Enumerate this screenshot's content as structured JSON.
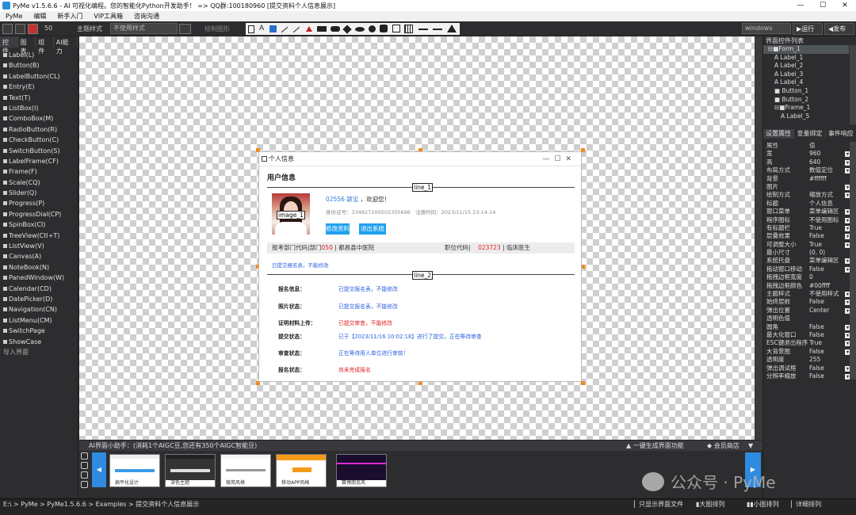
{
  "title_bar": {
    "text": "PyMe v1.5.6.6 - AI 可视化编程。您的智能化Python开发助手！ => QQ群:100180960    [提交资料个人信息展示]",
    "min": "—",
    "max": "☐",
    "close": "✕"
  },
  "menu": [
    "PyMe",
    "编辑",
    "新手入门",
    "VIP工具箱",
    "咨询沟通"
  ],
  "toolbar": {
    "zoom": "50",
    "theme_label": "主题样式",
    "theme_value": "不使用样式",
    "draw_label": "绘制图形",
    "platform": "windows",
    "run": "▶运行",
    "publish": "◀发布"
  },
  "left_panel": {
    "tabs": [
      "控件",
      "图表",
      "组件",
      "AI能力"
    ],
    "controls": [
      "Label(L)",
      "Button(B)",
      "LabelButton(CL)",
      "Entry(E)",
      "Text(T)",
      "ListBox(I)",
      "ComboBox(M)",
      "RadioButton(R)",
      "CheckButton(C)",
      "SwitchButton(S)",
      "LabelFrame(CF)",
      "Frame(F)",
      "Scale(CQ)",
      "Slider(Q)",
      "Progress(P)",
      "ProgressDial(CP)",
      "SpinBox(CI)",
      "TreeView(Ctl+T)",
      "ListView(V)",
      "Canvas(A)",
      "NoteBook(N)",
      "PanedWindow(W)",
      "Calendar(CD)",
      "DatePicker(D)",
      "Navigation(CN)",
      "ListMenu(CM)",
      "SwitchPage",
      "ShowCase"
    ],
    "import": "导入界面"
  },
  "form": {
    "title": "个人信息",
    "section": "用户信息",
    "line1": "line_1",
    "line2": "line_2",
    "image_tag": "image_1",
    "user_code": "02556",
    "user_name": "颖宝",
    "welcome": "，欢迎您！",
    "id_label": "身份证号：",
    "id_value": "334827200502305696",
    "reg_label": "注册时间：",
    "reg_value": "2023/11/15  23:14:14",
    "btn_edit": "修改资料",
    "btn_exit": "退出系统",
    "row_left_prefix": "报考部门代码|部门",
    "row_left_code": "050",
    "row_left_name": "| 都昌县中医院",
    "row_right_prefix": "职位代码|",
    "row_right_code": "023723",
    "row_right_name": "| 临床医生",
    "notice": "已提交报名表，不能修改",
    "status_rows": [
      {
        "label": "报名信息：",
        "value": "已提交报名表，不能修改",
        "color": "#2a5fe0"
      },
      {
        "label": "照片状态：",
        "value": "已提交报名表，不能修改",
        "color": "#2a5fe0"
      },
      {
        "label": "证明材料上传：",
        "value": "已提交审查，不能修改",
        "color": "#e02020"
      },
      {
        "label": "提交状态：",
        "value": "已于【2023/11/16 10:02:18】进行了提交，正在等待审查",
        "color": "#2a5fe0"
      },
      {
        "label": "审查状态：",
        "value": "正在等待用人单位进行审核！",
        "color": "#2a5fe0"
      },
      {
        "label": "报名状态：",
        "value": "尚未完成报名",
        "color": "#e02020"
      }
    ]
  },
  "right_panel": {
    "tree_title": "界面控件列表",
    "tree": [
      {
        "t": "⊟■Form_1",
        "i": 0
      },
      {
        "t": "A Label_1",
        "i": 1
      },
      {
        "t": "A Label_2",
        "i": 1
      },
      {
        "t": "A Label_3",
        "i": 1
      },
      {
        "t": "A Label_4",
        "i": 1
      },
      {
        "t": "■ Button_1",
        "i": 1
      },
      {
        "t": "■ Button_2",
        "i": 1
      },
      {
        "t": "⊟■Frame_1",
        "i": 1
      },
      {
        "t": "A Label_5",
        "i": 2
      }
    ],
    "tabs": [
      "设置属性",
      "变量绑定",
      "事件响应"
    ],
    "props_header": [
      "属性",
      "值"
    ],
    "props": [
      [
        "宽",
        "960",
        true
      ],
      [
        "高",
        "640",
        true
      ],
      [
        "布局方式",
        "数值定位",
        true
      ],
      [
        "背景",
        "#ffffff",
        false
      ],
      [
        "图片",
        "",
        true
      ],
      [
        "绘制方式",
        "缩放方式",
        true
      ],
      [
        "标题",
        "个人信息",
        false
      ],
      [
        "窗口菜单",
        "菜单编辑区",
        true
      ],
      [
        "程序图标",
        "不使用图标",
        true
      ],
      [
        "有标题栏",
        "True",
        true
      ],
      [
        "层叠效果",
        "False",
        true
      ],
      [
        "可调整大小",
        "True",
        true
      ],
      [
        "最小尺寸",
        "(0, 0)",
        false
      ],
      [
        "系统托盘",
        "菜单编辑区",
        true
      ],
      [
        "拖动窗口移动",
        "False",
        true
      ],
      [
        "拖拽边框宽度",
        "0",
        false
      ],
      [
        "拖拽边框颜色",
        "#00ffff",
        false
      ],
      [
        "主题样式",
        "不使用样式",
        true
      ],
      [
        "始终层前",
        "False",
        true
      ],
      [
        "弹出位置",
        "Center",
        true
      ],
      [
        "透明色值",
        "",
        false
      ],
      [
        "圆角",
        "False",
        true
      ],
      [
        "最大化窗口",
        "False",
        true
      ],
      [
        "ESC键退出程序",
        "True",
        true
      ],
      [
        "大背景图",
        "False",
        true
      ],
      [
        "透明度",
        "255",
        false
      ],
      [
        "弹出调试框",
        "False",
        true
      ],
      [
        "分辨率缩放",
        "False",
        true
      ]
    ]
  },
  "ai_bar": {
    "text": "AI界面小助手：(消耗1个AIGC豆,您还有350个AIGC智能豆)",
    "gen": "一键生成界面功能",
    "shop": "会员商店"
  },
  "templates": [
    "扁平化设计",
    "深色主题",
    "极简风格",
    "移动APP风格",
    "赛博朋克风"
  ],
  "status": {
    "path": "E:\\ > PyMe > PyMe1.5.6.6 > Examples > 提交资料个人信息展示",
    "only_files": "只显示界面文件",
    "large": "大图排列",
    "small": "小图排列",
    "detail": "详细排列"
  },
  "watermark": "公众号 · PyMe"
}
